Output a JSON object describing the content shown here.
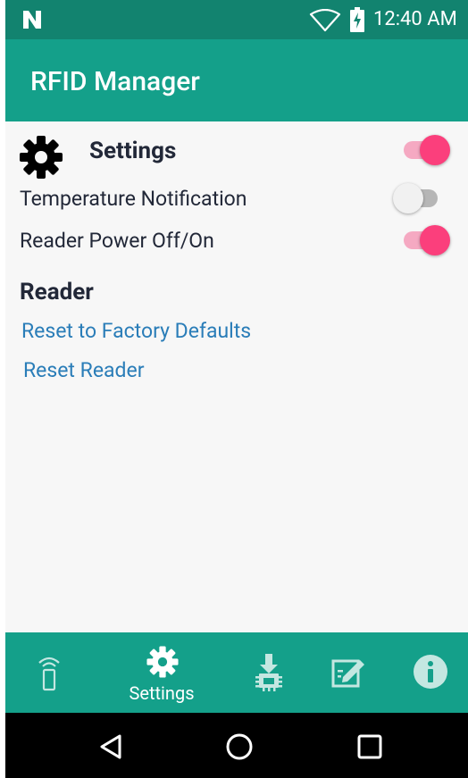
{
  "status_bar": {
    "time": "12:40 AM"
  },
  "app_bar": {
    "title": "RFID Manager"
  },
  "settings": {
    "title": "Settings",
    "settings_toggle_on": true,
    "temperature_notification": {
      "label": "Temperature Notification",
      "enabled": false
    },
    "reader_power": {
      "label": "Reader Power Off/On",
      "enabled": true
    }
  },
  "reader": {
    "title": "Reader",
    "links": [
      "Reset to Factory Defaults",
      "Reset Reader"
    ]
  },
  "bottom_nav": {
    "active": "Settings",
    "items": [
      {
        "icon": "rfid-reader-icon",
        "label": ""
      },
      {
        "icon": "gear-icon",
        "label": "Settings"
      },
      {
        "icon": "firmware-update-icon",
        "label": ""
      },
      {
        "icon": "edit-icon",
        "label": ""
      },
      {
        "icon": "info-icon",
        "label": ""
      }
    ]
  },
  "colors": {
    "status_bar": "#12836f",
    "app_bar": "#14a08a",
    "accent": "#fb3f7c",
    "link": "#2a7db8",
    "text": "#222838"
  }
}
